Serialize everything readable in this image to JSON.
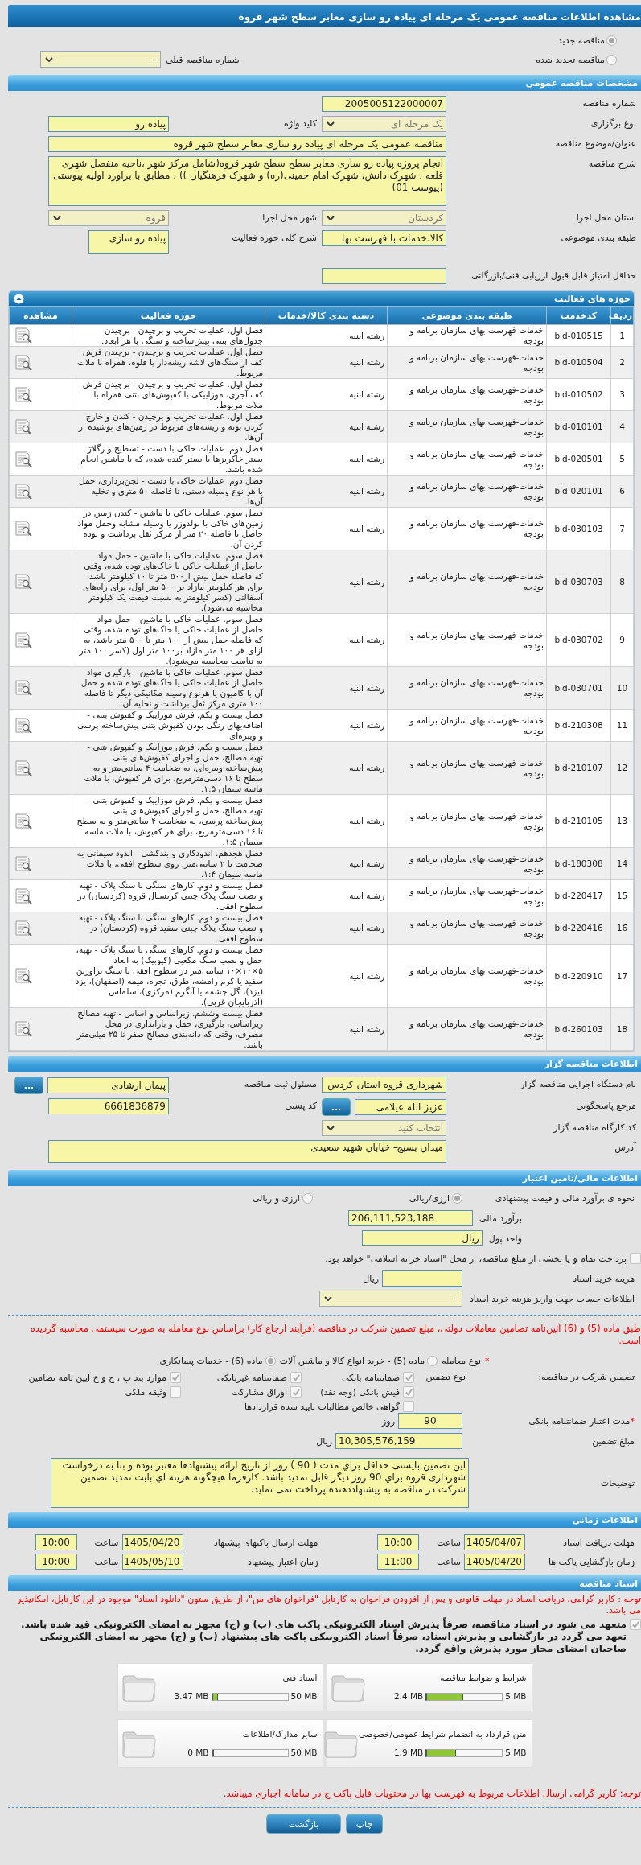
{
  "title": "مشاهده اطلاعات مناقصه عمومی یک مرحله ای پیاده رو سازی معابر سطح شهر قروه",
  "tender_kind": [
    {
      "label": "مناقصه جدید",
      "selected": true
    },
    {
      "label": "مناقصه تجدید شده",
      "selected": false
    }
  ],
  "previous_tender": {
    "label": "شماره مناقصه قبلی",
    "value": "--"
  },
  "general": {
    "heading": "مشخصات مناقصه عمومی",
    "rows": [
      {
        "fields": [
          {
            "label": "شماره مناقصه",
            "value": "2005005122000007",
            "kind": "text"
          }
        ]
      },
      {
        "fields": [
          {
            "label": "نوع برگزاری",
            "value": "یک مرحله ای",
            "kind": "select"
          },
          {
            "label": "کلید واژه",
            "value": "پیاده رو",
            "kind": "text"
          }
        ]
      },
      {
        "fields": [
          {
            "label": "عنوان/موضوع مناقصه",
            "value": "مناقصه عمومی یک مرحله ای پیاده  رو سازی معابر سطح شهر قروه",
            "kind": "wide"
          }
        ]
      },
      {
        "fields": [
          {
            "label": "شرح مناقصه",
            "value": "انجام پروژه پیاده  رو سازی معابر سطح سطح شهر قروه(شامل  مرکز شهر ،ناحیه منفصل شهری قلعه ، شهرک دانش، شهرک امام خمینی(ره) و شهرک فرهنگیان )) ، مطابق با براورد اولیه پیوستی (پیوست 01)",
            "kind": "area"
          }
        ]
      },
      {
        "fields": [
          {
            "label": "استان محل اجرا",
            "value": "کردستان",
            "kind": "select"
          },
          {
            "label": "شهر محل اجرا",
            "value": "قروه",
            "kind": "select"
          }
        ]
      },
      {
        "fields": [
          {
            "label": "طبقه بندی موضوعی",
            "value": "کالا،خدمات با فهرست بها",
            "kind": "text"
          },
          {
            "label": "شرح کلی حوزه فعالیت",
            "value": "پیاده رو سازی",
            "kind": "box"
          }
        ]
      },
      {
        "fields": [
          {
            "label": "حداقل امتیاز قابل قبول ارزیابی فنی/بازرگانی",
            "kind": "text"
          }
        ]
      }
    ]
  },
  "activities": {
    "heading": "حوزه های فعالیت",
    "columns": [
      "ردیف",
      "کدخدمت",
      "طبقه بندی موضوعی",
      "دسته بندی کالا/خدمات",
      "حوزه فعالیت",
      "مشاهده"
    ],
    "rows": [
      {
        "num": "1",
        "code": "bld-010515",
        "category": "خدمات-فهرست بهای سازمان برنامه و بودجه",
        "group": "رشته ابنیه",
        "activity": "فصل اول. عملیات تخریب و برچیدن - برچیدن جدول‌های بتنی پیش‌ساخته و سنگی با هر ابعاد."
      },
      {
        "num": "2",
        "code": "bld-010504",
        "category": "خدمات-فهرست بهای سازمان برنامه و بودجه",
        "group": "رشته ابنیه",
        "activity": "فصل اول. عملیات تخریب و برچیدن - برچیدن فرش کف از سنگ‌های لاشه ریشه‌دار یا قلوه، همراه با ملات مربوط."
      },
      {
        "num": "3",
        "code": "bld-010502",
        "category": "خدمات-فهرست بهای سازمان برنامه و بودجه",
        "group": "رشته ابنیه",
        "activity": "فصل اول. عملیات تخریب و برچیدن - برچیدن فرش کف آجری، موزاییکی یا کفپوش‌های بتنی همراه با ملات مربوط."
      },
      {
        "num": "4",
        "code": "bld-010101",
        "category": "خدمات-فهرست بهای سازمان برنامه و بودجه",
        "group": "رشته ابنیه",
        "activity": "فصل اول. عملیات تخریب و برچیدن - کندن و خارج کردن بوته و ریشه‌های مربوط در زمین‌های پوشیده از آن‌ها."
      },
      {
        "num": "5",
        "code": "bld-020501",
        "category": "خدمات-فهرست بهای سازمان برنامه و بودجه",
        "group": "رشته ابنیه",
        "activity": "فصل دوم. عملیات خاکی با دست - تسطیح و رگلاژ بستر خاکریزها یا بستر کنده شده، که با ماشین انجام شده باشد."
      },
      {
        "num": "6",
        "code": "bld-020101",
        "category": "خدمات-فهرست بهای سازمان برنامه و بودجه",
        "group": "رشته ابنیه",
        "activity": "فصل دوم. عملیات خاکی با دست - لجن‌برداری، حمل با هر نوع وسیله دستی، تا فاصله ۵۰ متری و تخلیه آن‌ها."
      },
      {
        "num": "7",
        "code": "bld-030103",
        "category": "خدمات-فهرست بهای سازمان برنامه و بودجه",
        "group": "رشته ابنیه",
        "activity": "فصل سوم. عملیات خاکی با ماشین - کندن زمین در زمین‌های خاکی با بولدوزر یا وسیله مشابه وحمل مواد حاصل تا فاصله ۲۰ متر از مرکز ثقل برداشت و توده کردن آن."
      },
      {
        "num": "8",
        "code": "bld-030703",
        "category": "خدمات-فهرست بهای سازمان برنامه و بودجه",
        "group": "رشته ابنیه",
        "activity": "فصل سوم. عملیات خاکی با ماشین - حمل مواد حاصل از عملیات خاکی یا خاک‌های توده شده، وقتی  که فاصله حمل بیش از۵۰۰ متر تا ۱۰ کیلومتر باشد، برای هر کیلومتر مازاد بر ۵۰۰  متر اول، برای راه‌های آسفالتی (کسر کیلومتر به نسبت قیمت یک کیلومتر محاسبه می‌شود)."
      },
      {
        "num": "9",
        "code": "bld-030702",
        "category": "خدمات-فهرست بهای سازمان برنامه و بودجه",
        "group": "رشته ابنیه",
        "activity": "فصل سوم. عملیات خاکی با ماشین - حمل مواد حاصل از عملیات خاکی یا خاک‌های توده شده، وقتی که فاصله حمل بیش از ۱۰۰ متر تا ۵۰۰ متر باشد، به ازای هر ۱۰۰ متر مازاد بر۱۰۰ متر اول (کسر ۱۰۰ متر به تناسب محاسبه می‌شود)."
      },
      {
        "num": "10",
        "code": "bld-030701",
        "category": "خدمات-فهرست بهای سازمان برنامه و بودجه",
        "group": "رشته ابنیه",
        "activity": "فصل سوم. عملیات خاکی با ماشین - بارگیری مواد حاصل از عملیات خاکی یا خاک‌های توده شده و حمل آن با کامیون یا هرنوع وسیله مکانیکی دیگر تا فاصله ۱۰۰ متری مرکز ثقل  برداشت و تخلیه آن."
      },
      {
        "num": "11",
        "code": "bld-210308",
        "category": "خدمات-فهرست بهای سازمان برنامه و بودجه",
        "group": "رشته ابنیه",
        "activity": "فصل بیست و یکم. فرش موزاییک و کفپوش بتنی - اضافه‌بهای رنگی بودن کفپوش بتنی پیش‌ساخته پرسی و ویبره‌ای."
      },
      {
        "num": "12",
        "code": "bld-210107",
        "category": "خدمات-فهرست بهای سازمان برنامه و بودجه",
        "group": "رشته ابنیه",
        "activity": "فصل بیست و یکم. فرش موزاییک و کفپوش بتنی - تهیه مصالح، حمل و اجرای کفپوش‌های بتنی پیش‌ساخته ویبره‌ای، به ضخامت ۴ سانتی‌متر و به سطح تا ۱۶ دسی‌مترمربع، برای هر کفپوش، با ملات ماسه سیمان ۱:۵."
      },
      {
        "num": "13",
        "code": "bld-210105",
        "category": "خدمات-فهرست بهای سازمان برنامه و بودجه",
        "group": "رشته ابنیه",
        "activity": "فصل بیست و یکم. فرش موزاییک و کفپوش بتنی - تهیه مصالح، حمل و اجرای کفپوش‌های بتنی پیش‌ساخته پرسی، به ضخامت ۴ سانتی‌متر و به سطح تا ۱۶ دسی‌مترمربع، برای هر کفپوش، با ملات ماسه سیمان ۱:۵."
      },
      {
        "num": "14",
        "code": "bld-180308",
        "category": "خدمات-فهرست بهای سازمان برنامه و بودجه",
        "group": "رشته ابنیه",
        "activity": "فصل هجدهم. اندودکاری و بندکشی - اندود سیمانی به ضخامت تا ۲ سانتی‌متر، روی سطوح افقی، با ملات ماسه سیمان ۱:۴."
      },
      {
        "num": "15",
        "code": "bld-220417",
        "category": "خدمات-فهرست بهای سازمان برنامه و بودجه",
        "group": "رشته ابنیه",
        "activity": "فصل بیست و دوم. کارهای سنگی با سنگ پلاک - تهیه و نصب سنگ پلاک چینی کریستال قروه (کردستان) در سطوح افقی."
      },
      {
        "num": "16",
        "code": "bld-220416",
        "category": "خدمات-فهرست بهای سازمان برنامه و بودجه",
        "group": "رشته ابنیه",
        "activity": "فصل بیست و دوم. کارهای سنگی با سنگ پلاک - تهیه و نصب سنگ پلاک چینی سفید قروه (کردستان) در سطوح افقی."
      },
      {
        "num": "17",
        "code": "bld-220910",
        "category": "خدمات-فهرست بهای سازمان برنامه و بودجه",
        "group": "رشته ابنیه",
        "activity": "فصل بیست و دوم. کارهای سنگی با سنگ پلاک - تهیه، حمل و نصب سنگ مکعبی (کیوبیک) به ابعاد ۵×۱۰×۱۰ سانتی‌متر در سطوح افقی با سنگ تراورتن سفید یا کرم رامشه، طرق، تجره، میمه (اصفهان)، یزد (یزد)، گل چشمه یا آبگرم (مرکزی)، سلماس (آذربایجان غربی)."
      },
      {
        "num": "18",
        "code": "bld-260103",
        "category": "خدمات-فهرست بهای سازمان برنامه و بودجه",
        "group": "رشته ابنیه",
        "activity": "فصل بیست وششم. زیراساس و اساس - تهیه مصالح زیراساس، بارگیری، حمل و باراندازی در محل مصرف، وقتی که دانه‌بندی مصالح صفر تا ۲۵ میلی‌متر باشد."
      }
    ]
  },
  "organizer": {
    "heading": "اطلاعات مناقصه گزار",
    "rows": [
      {
        "fields": [
          {
            "label": "نام دستگاه اجرایی مناقصه گزار",
            "value": "شهرداری قروه استان کردس",
            "kind": "text"
          },
          {
            "label": "مسئول ثبت مناقصه",
            "value": "پیمان  ارشادی",
            "kind": "text",
            "button": "..."
          }
        ]
      },
      {
        "fields": [
          {
            "label": "مرجع پاسخگویی",
            "value": "عزیز الله عیلامی",
            "kind": "text",
            "button": "..."
          },
          {
            "label": "کد پستی",
            "value": "6661836879",
            "kind": "text"
          }
        ]
      },
      {
        "fields": [
          {
            "label": "کد کارگاه مناقصه گزار",
            "value": "انتخاب کنید",
            "kind": "select"
          }
        ]
      },
      {
        "fields": [
          {
            "label": "آدرس",
            "value": "میدان بسیج- خیابان شهید سعیدی",
            "kind": "area"
          }
        ]
      }
    ]
  },
  "finance": {
    "heading": "اطلاعات مالی/تامین اعتبار",
    "method": {
      "label": "نحوه ی برآورد مالی و قیمت پیشنهادی",
      "options": [
        {
          "label": "ارزی/ریالی",
          "selected": true
        },
        {
          "label": "ارزی و ریالی",
          "selected": false
        }
      ]
    },
    "estimate": {
      "label": "برآورد مالی",
      "value": "206,111,523,188"
    },
    "currency": {
      "label": "واحد پول",
      "value": "ریال"
    },
    "treasury": {
      "label": "پرداخت تمام و یا بخشی از مبلغ مناقصه، از محل \"اسناد خزانه اسلامی\" خواهد بود.",
      "checked": false
    },
    "doc_fee": {
      "label": "هزینه خرید اسناد",
      "unit": "ریال"
    },
    "account": {
      "label": "اطلاعات حساب جهت واریز هزینه خرید اسناد",
      "value": "--"
    },
    "notice": "طبق ماده (5) و (6) آئین‌نامه تضامین معاملات دولتی، مبلغ تضمین شرکت در مناقصه (فرآیند ارجاع کار) براساس نوع معامله به صورت سیستمی محاسبه گردیده است.",
    "deal_type": {
      "mark": "*",
      "label": "نوع معامله",
      "options": [
        {
          "label": "ماده (5) - خرید انواع کالا و ماشین آلات",
          "selected": false
        },
        {
          "label": "ماده (6) - خدمات پیمانکاری",
          "selected": true
        }
      ]
    },
    "guarantee": {
      "label": "تضمین شرکت در مناقصه:",
      "type_label": "نوع تضمین",
      "options": [
        {
          "label": "ضمانتنامه بانکی",
          "checked": true
        },
        {
          "label": "ضمانتنامه غیربانکی",
          "checked": true
        },
        {
          "label": "موارد بند پ ، ح و خ آیین نامه تضامین",
          "checked": true
        },
        {
          "label": "فیش بانکی (وجه نقد)",
          "checked": true
        },
        {
          "label": "اوراق مشارکت",
          "checked": true
        },
        {
          "label": "وثیقه ملکی",
          "checked": false
        },
        {
          "label": "گواهی خالص مطالبات تایید شده قراردادها",
          "checked": false
        }
      ]
    },
    "validity": {
      "mark": "*",
      "label": "مدت اعتبار ضمانتنامه بانکی",
      "value": "90",
      "unit": "روز"
    },
    "amount": {
      "label": "مبلغ تضمین",
      "value": "10,305,576,159",
      "unit": "ریال"
    },
    "notes": {
      "label": "توضیحات",
      "value": "این تضمین بایستی حداقل براي مدت ( 90 ) روز از تاریخ ارائه پیشنهادها معتبر بوده و بنا به درخواست شهرداری قروه براي 90 روز دیگر قابل تمدید باشد. کارفرما هیچگونه هزینه اي بابت تمدید تضمین شرکت در مناقصه به پیشنهاددهنده پرداخت نمی نماید."
    }
  },
  "timing": {
    "heading": "اطلاعات زمانی",
    "rows": [
      [
        {
          "label": "مهلت دریافت اسناد",
          "date": "1405/04/07",
          "time_label": "ساعت",
          "time": "10:00"
        },
        {
          "label": "مهلت ارسال پاکتهای پیشنهاد",
          "date": "1405/04/20",
          "time_label": "ساعت",
          "time": "10:00"
        }
      ],
      [
        {
          "label": "زمان بازگشایی پاکت ها",
          "date": "1405/04/20",
          "time_label": "ساعت",
          "time": "11:00"
        },
        {
          "label": "زمان اعتبار پیشنهاد",
          "date": "1405/05/10",
          "time_label": "ساعت",
          "time": "10:00"
        }
      ]
    ]
  },
  "documents": {
    "heading": "اسناد مناقصه",
    "notice": "توجه : کاربر گرامی، دریافت اسناد در مهلت قانونی و پس از افزودن فراخوان به کارتابل \"فراخوان های من\"، از طریق ستون \"دانلود اسناد\" موجود در این کارتابل، امکانپذیر می باشد.",
    "commitment": {
      "label": "متعهد می شود در اسناد مناقصه، صرفاً پذیرش اسناد الکترونیکی پاکت های (ب) و (ج) مجهز به امضای الکترونیکی قید شده باشد. تعهد می گردد در بازگشایی و پذیرش اسناد، صرفاً اسناد الکترونیکی پاکت های پیشنهاد (ب) و (ج) مجهز به امضای الکترونیکی صاحبان امضای مجاز مورد پذیرش واقع گردد.",
      "checked": true
    },
    "files": [
      {
        "name": "شرایط و ضوابط مناقصه",
        "max": "5 MB",
        "used": "2.4 MB",
        "level": 0.48
      },
      {
        "name": "اسناد فنی",
        "max": "50 MB",
        "used": "3.47 MB",
        "level": 0.07
      },
      {
        "name": "متن قرارداد به انضمام شرایط عمومی/خصوصی",
        "max": "5 MB",
        "used": "1.9 MB",
        "level": 0.38
      },
      {
        "name": "سایر مدارک/اطلاعات",
        "max": "50 MB",
        "used": "0 MB",
        "level": 0
      }
    ],
    "footer_notice": "توجه: کاربر گرامی ارسال اطلاعات مربوط به فهرست بها در محتویات فایل پاکت ج در سامانه اجباری میباشد."
  },
  "buttons": [
    "چاپ",
    "بازگشت"
  ]
}
